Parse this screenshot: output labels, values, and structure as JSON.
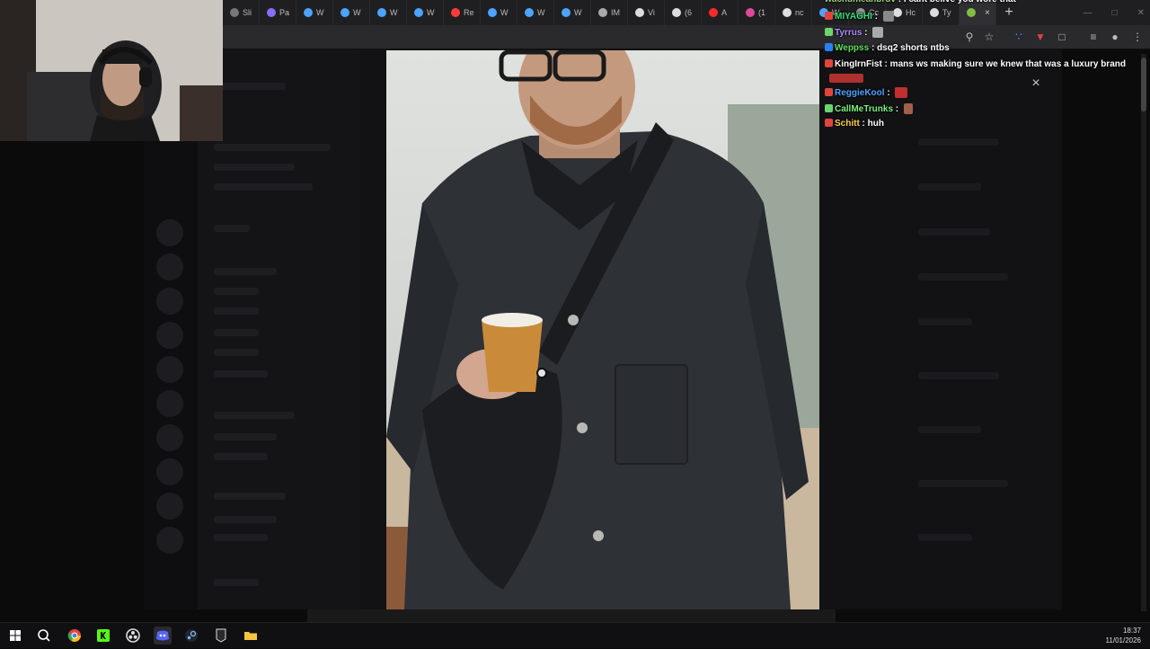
{
  "browser": {
    "tabs": [
      {
        "label": "Sli",
        "favicon_color": "#777777"
      },
      {
        "label": "Pa",
        "favicon_color": "#8a6cff"
      },
      {
        "label": "W",
        "favicon_color": "#4da3ff"
      },
      {
        "label": "W",
        "favicon_color": "#4da3ff"
      },
      {
        "label": "W",
        "favicon_color": "#4da3ff"
      },
      {
        "label": "W",
        "favicon_color": "#4da3ff"
      },
      {
        "label": "Re",
        "favicon_color": "#ff3b3b"
      },
      {
        "label": "W",
        "favicon_color": "#4da3ff"
      },
      {
        "label": "W",
        "favicon_color": "#4da3ff"
      },
      {
        "label": "W",
        "favicon_color": "#4da3ff"
      },
      {
        "label": "IM",
        "favicon_color": "#aaaaaa"
      },
      {
        "label": "Vi",
        "favicon_color": "#dddddd"
      },
      {
        "label": "(6",
        "favicon_color": "#dddddd"
      },
      {
        "label": "A",
        "favicon_color": "#ff2a2a"
      },
      {
        "label": "(1",
        "favicon_color": "#e0489a"
      },
      {
        "label": "nc",
        "favicon_color": "#dddddd"
      },
      {
        "label": "W",
        "favicon_color": "#4da3ff"
      },
      {
        "label": "Cc",
        "favicon_color": "#999999"
      },
      {
        "label": "Hc",
        "favicon_color": "#dddddd"
      },
      {
        "label": "Ty",
        "favicon_color": "#dddddd"
      },
      {
        "label": "",
        "favicon_color": "#7fbf3f",
        "active": true
      }
    ],
    "new_tab_label": "+",
    "close_tab_label": "×"
  },
  "chat": {
    "messages": [
      {
        "user": "wachumeanbruv",
        "color": "#9ad37a",
        "text": "I cant belive you wore that"
      },
      {
        "user": "MIYAGHI",
        "color": "#39e07a",
        "text": ""
      },
      {
        "user": "Tyrrus",
        "color": "#b18cff",
        "text": ""
      },
      {
        "user": "Weppss",
        "color": "#5fe05f",
        "text": "dsq2 shorts ntbs"
      },
      {
        "user": "KingIrnFist",
        "color": "#ffffff",
        "text": "mans ws making sure we knew that was a luxury brand"
      },
      {
        "user": "ReggieKool",
        "color": "#4ea3ff",
        "text": ""
      },
      {
        "user": "CallMeTrunks",
        "color": "#7cf07c",
        "text": ""
      },
      {
        "user": "Schitt",
        "color": "#ffd24a",
        "text": "huh"
      }
    ],
    "separator": ":"
  },
  "overlay": {
    "close_label": "×"
  },
  "taskbar": {
    "time": "18:37",
    "date": "11/01/2026"
  }
}
